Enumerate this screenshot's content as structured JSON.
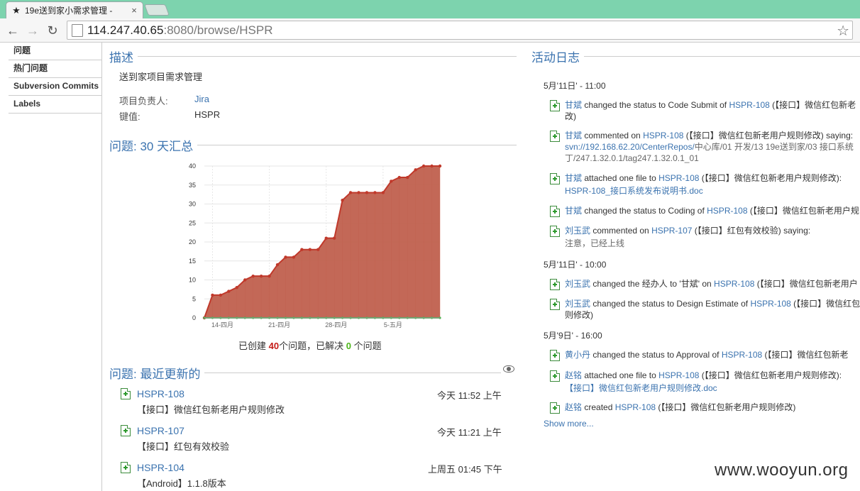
{
  "browser": {
    "tab_title": "19e送到家小需求管理 - ",
    "tab_close": "×",
    "url_host": "114.247.40.65",
    "url_rest": ":8080/browse/HSPR"
  },
  "sidebar": {
    "items": [
      {
        "label": "问题"
      },
      {
        "label": "热门问题"
      },
      {
        "label": "Subversion Commits"
      },
      {
        "label": "Labels"
      }
    ]
  },
  "description": {
    "heading": "描述",
    "text": "送到家项目需求管理",
    "lead_label": "项目负责人:",
    "lead_value": "Jira",
    "key_label": "键值:",
    "key_value": "HSPR"
  },
  "summary_section": {
    "heading": "问题: 30 天汇总",
    "created_prefix": "已创建 ",
    "created_count": "40",
    "created_suffix": "个问题，已解决 ",
    "resolved_count": "0",
    "resolved_suffix": " 个问题"
  },
  "chart_data": {
    "type": "area",
    "y_ticks": [
      "0",
      "5",
      "10",
      "15",
      "20",
      "25",
      "30",
      "35",
      "40"
    ],
    "x_ticks": [
      "14-四月",
      "21-四月",
      "28-四月",
      "5-五月"
    ],
    "ylim": [
      0,
      40
    ],
    "series": [
      {
        "values": [
          0,
          6,
          6,
          7,
          8,
          10,
          11,
          11,
          11,
          14,
          16,
          16,
          18,
          18,
          18,
          21,
          21,
          31,
          33,
          33,
          33,
          33,
          33,
          36,
          37,
          37,
          39,
          40,
          40,
          40
        ]
      },
      {
        "values": [
          0,
          0,
          0,
          0,
          0,
          0,
          0,
          0,
          0,
          0,
          0,
          0,
          0,
          0,
          0,
          0,
          0,
          0,
          0,
          0,
          0,
          0,
          0,
          0,
          0,
          0,
          0,
          0,
          0,
          0
        ]
      }
    ],
    "colors": {
      "created": "#c0392b",
      "created_fill": "#c0604e",
      "resolved": "#4caf50"
    }
  },
  "recent": {
    "heading": "问题: 最近更新的",
    "items": [
      {
        "key": "HSPR-108",
        "title": "【接口】微信红包新老用户规则修改",
        "time": "今天 11:52 上午"
      },
      {
        "key": "HSPR-107",
        "title": "【接口】红包有效校验",
        "time": "今天 11:21 上午"
      },
      {
        "key": "HSPR-104",
        "title": "【Android】1.1.8版本",
        "time": "上周五 01:45 下午"
      }
    ]
  },
  "activity": {
    "heading": "活动日志",
    "groups": [
      {
        "date": "5月'11日' - 11:00"
      },
      {
        "date": "5月'11日' - 10:00"
      },
      {
        "date": "5月'9日' - 16:00"
      }
    ],
    "entries": [
      {
        "user": "甘斌",
        "action": " changed the status to Code Submit of ",
        "key": "HSPR-108",
        "rest": " (【接口】微信红包新老",
        "line2": "改)",
        "line2_link": ""
      },
      {
        "user": "甘斌",
        "action": " commented on ",
        "key": "HSPR-108",
        "rest": " (【接口】微信红包新老用户规则修改) saying:",
        "line2": "",
        "line2_link": "svn://192.168.62.20/CenterRepos/",
        "line2b": "中心库/01 开发/13 19e送到家/03 接口系统",
        "line3": "丁/247.1.32.0.1/tag247.1.32.0.1_01"
      },
      {
        "user": "甘斌",
        "action": " attached one file to ",
        "key": "HSPR-108",
        "rest": " (【接口】微信红包新老用户规则修改):",
        "line2": "",
        "line2_link": "HSPR-108_接口系统发布说明书.doc"
      },
      {
        "user": "甘斌",
        "action": " changed the status to Coding of ",
        "key": "HSPR-108",
        "rest": " (【接口】微信红包新老用户规",
        "line2": "",
        "line2_link": ""
      },
      {
        "user": "刘玉武",
        "action": " commented on ",
        "key": "HSPR-107",
        "rest": " (【接口】红包有效校验) saying:",
        "line2": "注意，已经上线",
        "line2_link": ""
      },
      {
        "user": "刘玉武",
        "action": " changed the 经办人 to '甘斌' on ",
        "key": "HSPR-108",
        "rest": " (【接口】微信红包新老用户",
        "line2": "",
        "line2_link": ""
      },
      {
        "user": "刘玉武",
        "action": " changed the status to Design Estimate of ",
        "key": "HSPR-108",
        "rest": " (【接口】微信红包",
        "line2": "则修改)",
        "line2_link": ""
      },
      {
        "user": "黄小丹",
        "action": " changed the status to Approval of ",
        "key": "HSPR-108",
        "rest": " (【接口】微信红包新老",
        "line2": "",
        "line2_link": ""
      },
      {
        "user": "赵铭",
        "action": " attached one file to ",
        "key": "HSPR-108",
        "rest": " (【接口】微信红包新老用户规则修改):",
        "line2": "",
        "line2_link": "【接口】微信红包新老用户规则修改.doc"
      },
      {
        "user": "赵铭",
        "action": " created ",
        "key": "HSPR-108",
        "rest": " (【接口】微信红包新老用户规则修改)",
        "line2": "",
        "line2_link": ""
      }
    ],
    "show_more": "Show more..."
  },
  "watermark": "www.wooyun.org"
}
